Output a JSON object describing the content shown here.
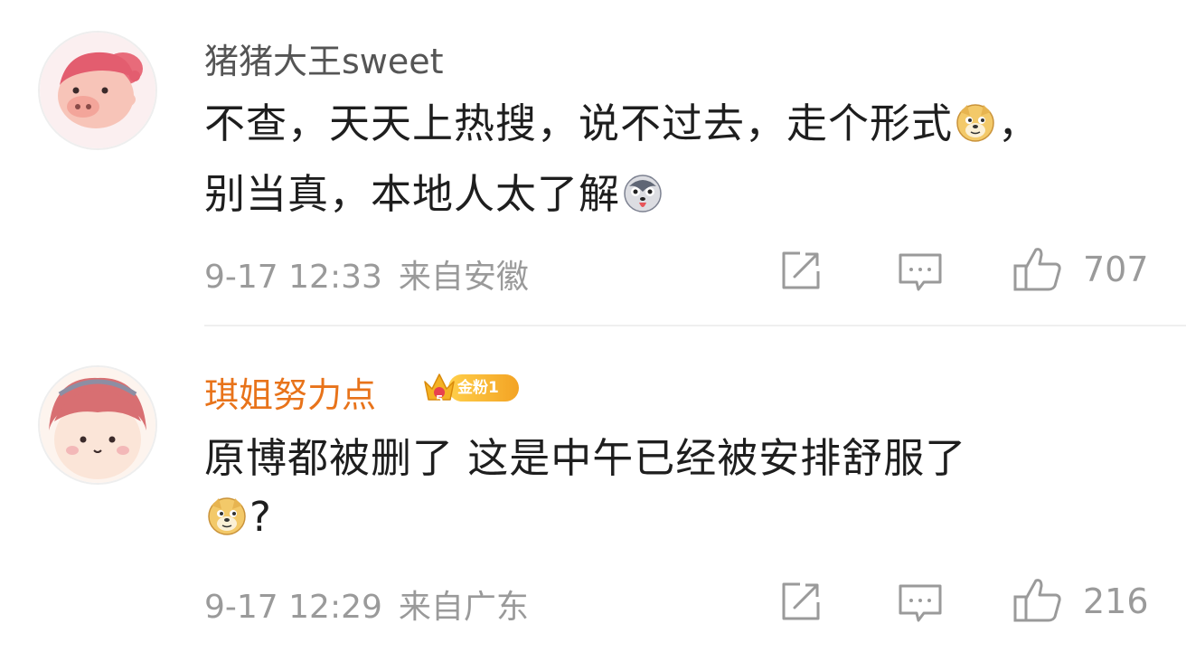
{
  "comments": [
    {
      "username": "猪猪大王sweet",
      "avatar_icon": "pink-pig-avatar-icon",
      "text_line1_a": "不查，天天上热搜，说不过去，走个形式",
      "text_line1_b": "，",
      "text_line2": "别当真，本地人太了解",
      "emoji_1": "doge-emoji-icon",
      "emoji_2": "husky-emoji-icon",
      "time": "9-17 12:33",
      "location": "来自安徽",
      "likes": "707"
    },
    {
      "username": "琪姐努力点",
      "avatar_icon": "cartoon-girl-avatar-icon",
      "badge_level": "5",
      "badge_text": "金粉1",
      "text_line1": "原博都被删了 这是中午已经被安排舒服了",
      "text_line2_suffix": "?",
      "emoji_1": "doge-emoji-icon",
      "time": "9-17 12:29",
      "location": "来自广东",
      "likes": "216"
    }
  ],
  "colors": {
    "primary_text": "#1e1e1e",
    "username_gray": "#555555",
    "username_orange": "#e8731a",
    "meta_gray": "#9a9a9a",
    "divider": "#efefef"
  },
  "icons": {
    "forward": "share-edit-icon",
    "comment": "comment-bubble-icon",
    "like": "thumbs-up-icon"
  }
}
